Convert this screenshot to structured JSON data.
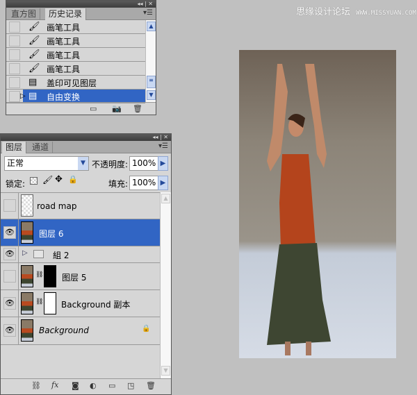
{
  "watermark": {
    "site_cn": "思缘设计论坛",
    "site_url": "WWW.MISSYUAN.COM"
  },
  "history_panel": {
    "tabs": [
      "直方图",
      "历史记录"
    ],
    "active_tab": 1,
    "items": [
      {
        "label": "画笔工具",
        "icon": "brush-icon"
      },
      {
        "label": "画笔工具",
        "icon": "brush-icon"
      },
      {
        "label": "画笔工具",
        "icon": "brush-icon"
      },
      {
        "label": "画笔工具",
        "icon": "brush-icon"
      },
      {
        "label": "盖印可见图层",
        "icon": "history-state-icon"
      },
      {
        "label": "自由变换",
        "icon": "history-state-icon",
        "selected": true
      }
    ]
  },
  "layers_panel": {
    "tabs": [
      "图层",
      "通道"
    ],
    "blend_mode": "正常",
    "opacity_label": "不透明度:",
    "opacity": "100%",
    "lock_label": "锁定:",
    "fill_label": "填充:",
    "fill": "100%",
    "layers": [
      {
        "name": "road map",
        "visible": false
      },
      {
        "name": "图层 6",
        "visible": true,
        "selected": true
      },
      {
        "name": "組 2",
        "visible": true,
        "group": true
      },
      {
        "name": "图层 5",
        "visible": false,
        "mask": "black"
      },
      {
        "name": "Background 副本",
        "visible": true,
        "mask": "white"
      },
      {
        "name": "Background",
        "visible": true,
        "locked": true
      }
    ]
  },
  "colors": {
    "selection": "#3165c4",
    "panel": "#d6d6d6",
    "background": "#c0c0c0"
  }
}
